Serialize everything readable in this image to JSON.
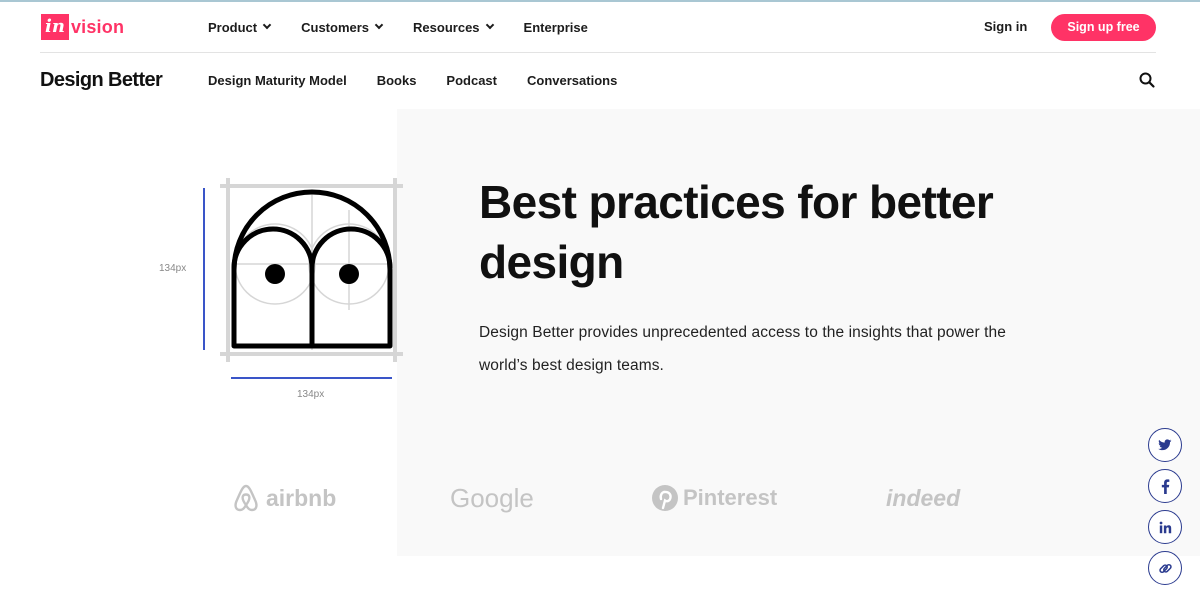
{
  "top_nav": {
    "logo_in": "in",
    "logo_vision": "vision",
    "items": [
      {
        "label": "Product"
      },
      {
        "label": "Customers"
      },
      {
        "label": "Resources"
      },
      {
        "label": "Enterprise"
      }
    ],
    "sign_in": "Sign in",
    "sign_up": "Sign up free"
  },
  "sub_nav": {
    "brand": "Design Better",
    "items": [
      {
        "label": "Design Maturity Model"
      },
      {
        "label": "Books"
      },
      {
        "label": "Podcast"
      },
      {
        "label": "Conversations"
      }
    ]
  },
  "hero": {
    "headline": "Best practices for better design",
    "subcopy": "Design Better provides unprecedented access to the insights that power the world’s best design teams.",
    "dim_vertical": "134px",
    "dim_horizontal": "134px"
  },
  "logos": {
    "airbnb": "airbnb",
    "google": "Google",
    "pinterest": "Pinterest",
    "indeed": "indeed"
  },
  "colors": {
    "brand_pink": "#ff3366",
    "social_blue": "#2b3b8f",
    "dimension_blue": "#3a55c8"
  },
  "icons": {
    "social": [
      "twitter-icon",
      "facebook-icon",
      "linkedin-icon",
      "link-icon"
    ],
    "search": "search-icon"
  }
}
